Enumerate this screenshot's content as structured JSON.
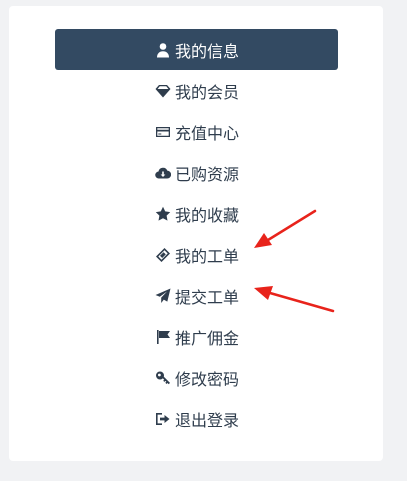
{
  "colors": {
    "active_bg": "#334a62",
    "text": "#2f3d4d",
    "arrow": "#e8231b"
  },
  "menu": {
    "items": [
      {
        "label": "我的信息",
        "icon": "user-icon",
        "active": true
      },
      {
        "label": "我的会员",
        "icon": "diamond-icon",
        "active": false
      },
      {
        "label": "充值中心",
        "icon": "credit-card-icon",
        "active": false
      },
      {
        "label": "已购资源",
        "icon": "cloud-download-icon",
        "active": false
      },
      {
        "label": "我的收藏",
        "icon": "star-icon",
        "active": false
      },
      {
        "label": "我的工单",
        "icon": "ticket-icon",
        "active": false
      },
      {
        "label": "提交工单",
        "icon": "paper-plane-icon",
        "active": false
      },
      {
        "label": "推广佣金",
        "icon": "flag-icon",
        "active": false
      },
      {
        "label": "修改密码",
        "icon": "key-icon",
        "active": false
      },
      {
        "label": "退出登录",
        "icon": "sign-out-icon",
        "active": false
      }
    ]
  },
  "annotations": [
    {
      "type": "arrow",
      "points_to": "我的工单"
    },
    {
      "type": "arrow",
      "points_to": "提交工单"
    }
  ]
}
